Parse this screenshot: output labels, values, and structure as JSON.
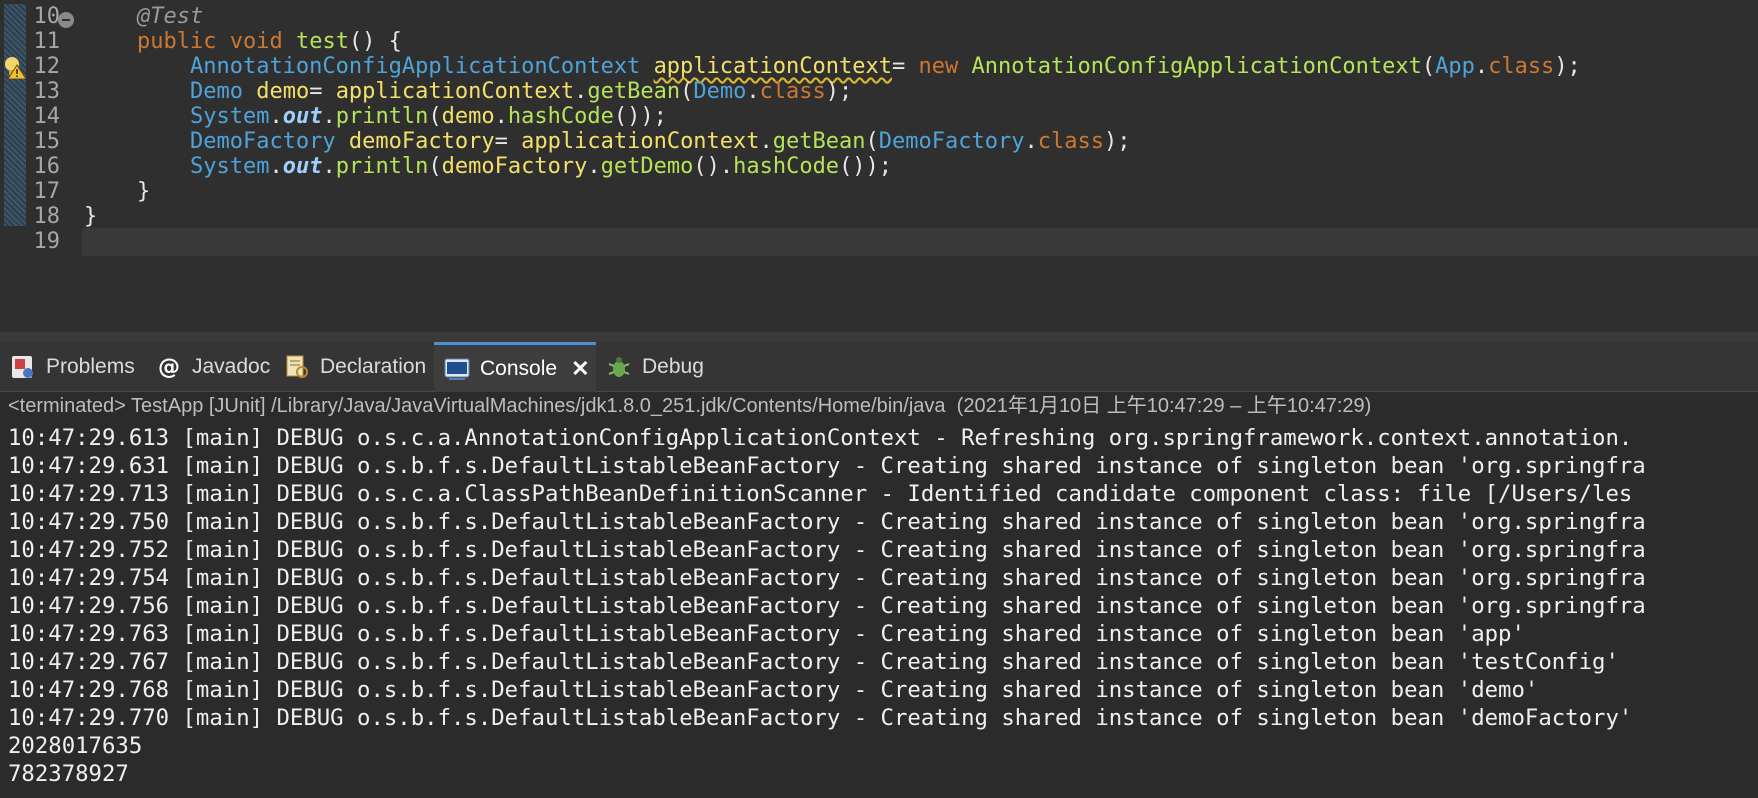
{
  "editor": {
    "lines": [
      {
        "num": "10",
        "segments": [
          {
            "t": "    "
          },
          {
            "t": "@Test",
            "c": "t-ann"
          }
        ]
      },
      {
        "num": "11",
        "segments": [
          {
            "t": "    "
          },
          {
            "t": "public",
            "c": "t-kw"
          },
          {
            "t": " "
          },
          {
            "t": "void",
            "c": "t-kw"
          },
          {
            "t": " "
          },
          {
            "t": "test",
            "c": "t-call"
          },
          {
            "t": "() {"
          }
        ]
      },
      {
        "num": "12",
        "segments": [
          {
            "t": "        "
          },
          {
            "t": "AnnotationConfigApplicationContext",
            "c": "t-type"
          },
          {
            "t": " "
          },
          {
            "t": "applicationContext",
            "c": "t-warnvar"
          },
          {
            "t": "= "
          },
          {
            "t": "new",
            "c": "t-kw"
          },
          {
            "t": " "
          },
          {
            "t": "AnnotationConfigApplicationContext",
            "c": "t-call"
          },
          {
            "t": "("
          },
          {
            "t": "App",
            "c": "t-type"
          },
          {
            "t": "."
          },
          {
            "t": "class",
            "c": "t-kw"
          },
          {
            "t": ");"
          }
        ]
      },
      {
        "num": "13",
        "segments": [
          {
            "t": "        "
          },
          {
            "t": "Demo",
            "c": "t-type"
          },
          {
            "t": " "
          },
          {
            "t": "demo",
            "c": "t-var"
          },
          {
            "t": "= "
          },
          {
            "t": "applicationContext",
            "c": "t-var"
          },
          {
            "t": "."
          },
          {
            "t": "getBean",
            "c": "t-call"
          },
          {
            "t": "("
          },
          {
            "t": "Demo",
            "c": "t-type"
          },
          {
            "t": "."
          },
          {
            "t": "class",
            "c": "t-kw"
          },
          {
            "t": ");"
          }
        ]
      },
      {
        "num": "14",
        "segments": [
          {
            "t": "        "
          },
          {
            "t": "System",
            "c": "t-type"
          },
          {
            "t": "."
          },
          {
            "t": "out",
            "c": "t-fld"
          },
          {
            "t": "."
          },
          {
            "t": "println",
            "c": "t-call"
          },
          {
            "t": "("
          },
          {
            "t": "demo",
            "c": "t-var"
          },
          {
            "t": "."
          },
          {
            "t": "hashCode",
            "c": "t-call"
          },
          {
            "t": "());"
          }
        ]
      },
      {
        "num": "15",
        "segments": [
          {
            "t": "        "
          },
          {
            "t": "DemoFactory",
            "c": "t-type"
          },
          {
            "t": " "
          },
          {
            "t": "demoFactory",
            "c": "t-var"
          },
          {
            "t": "= "
          },
          {
            "t": "applicationContext",
            "c": "t-var"
          },
          {
            "t": "."
          },
          {
            "t": "getBean",
            "c": "t-call"
          },
          {
            "t": "("
          },
          {
            "t": "DemoFactory",
            "c": "t-type"
          },
          {
            "t": "."
          },
          {
            "t": "class",
            "c": "t-kw"
          },
          {
            "t": ");"
          }
        ]
      },
      {
        "num": "16",
        "segments": [
          {
            "t": "        "
          },
          {
            "t": "System",
            "c": "t-type"
          },
          {
            "t": "."
          },
          {
            "t": "out",
            "c": "t-fld"
          },
          {
            "t": "."
          },
          {
            "t": "println",
            "c": "t-call"
          },
          {
            "t": "("
          },
          {
            "t": "demoFactory",
            "c": "t-var"
          },
          {
            "t": "."
          },
          {
            "t": "getDemo",
            "c": "t-call"
          },
          {
            "t": "()."
          },
          {
            "t": "hashCode",
            "c": "t-call"
          },
          {
            "t": "());"
          }
        ]
      },
      {
        "num": "17",
        "segments": [
          {
            "t": "    }"
          }
        ]
      },
      {
        "num": "18",
        "segments": [
          {
            "t": "}"
          }
        ]
      },
      {
        "num": "19",
        "segments": []
      }
    ]
  },
  "tabs": [
    {
      "label": "Problems",
      "icon": "problems-icon"
    },
    {
      "label": "Javadoc",
      "icon": "javadoc-icon"
    },
    {
      "label": "Declaration",
      "icon": "declaration-icon"
    },
    {
      "label": "Console",
      "icon": "console-icon",
      "active": true
    },
    {
      "label": "Debug",
      "icon": "debug-icon"
    }
  ],
  "console": {
    "header": "<terminated> TestApp [JUnit] /Library/Java/JavaVirtualMachines/jdk1.8.0_251.jdk/Contents/Home/bin/java  (2021年1月10日 上午10:47:29 – 上午10:47:29)",
    "lines": [
      "10:47:29.613 [main] DEBUG o.s.c.a.AnnotationConfigApplicationContext - Refreshing org.springframework.context.annotation.",
      "10:47:29.631 [main] DEBUG o.s.b.f.s.DefaultListableBeanFactory - Creating shared instance of singleton bean 'org.springfra",
      "10:47:29.713 [main] DEBUG o.s.c.a.ClassPathBeanDefinitionScanner - Identified candidate component class: file [/Users/les",
      "10:47:29.750 [main] DEBUG o.s.b.f.s.DefaultListableBeanFactory - Creating shared instance of singleton bean 'org.springfra",
      "10:47:29.752 [main] DEBUG o.s.b.f.s.DefaultListableBeanFactory - Creating shared instance of singleton bean 'org.springfra",
      "10:47:29.754 [main] DEBUG o.s.b.f.s.DefaultListableBeanFactory - Creating shared instance of singleton bean 'org.springfra",
      "10:47:29.756 [main] DEBUG o.s.b.f.s.DefaultListableBeanFactory - Creating shared instance of singleton bean 'org.springfra",
      "10:47:29.763 [main] DEBUG o.s.b.f.s.DefaultListableBeanFactory - Creating shared instance of singleton bean 'app'",
      "10:47:29.767 [main] DEBUG o.s.b.f.s.DefaultListableBeanFactory - Creating shared instance of singleton bean 'testConfig'",
      "10:47:29.768 [main] DEBUG o.s.b.f.s.DefaultListableBeanFactory - Creating shared instance of singleton bean 'demo'",
      "10:47:29.770 [main] DEBUG o.s.b.f.s.DefaultListableBeanFactory - Creating shared instance of singleton bean 'demoFactory'",
      "2028017635",
      "782378927"
    ]
  }
}
